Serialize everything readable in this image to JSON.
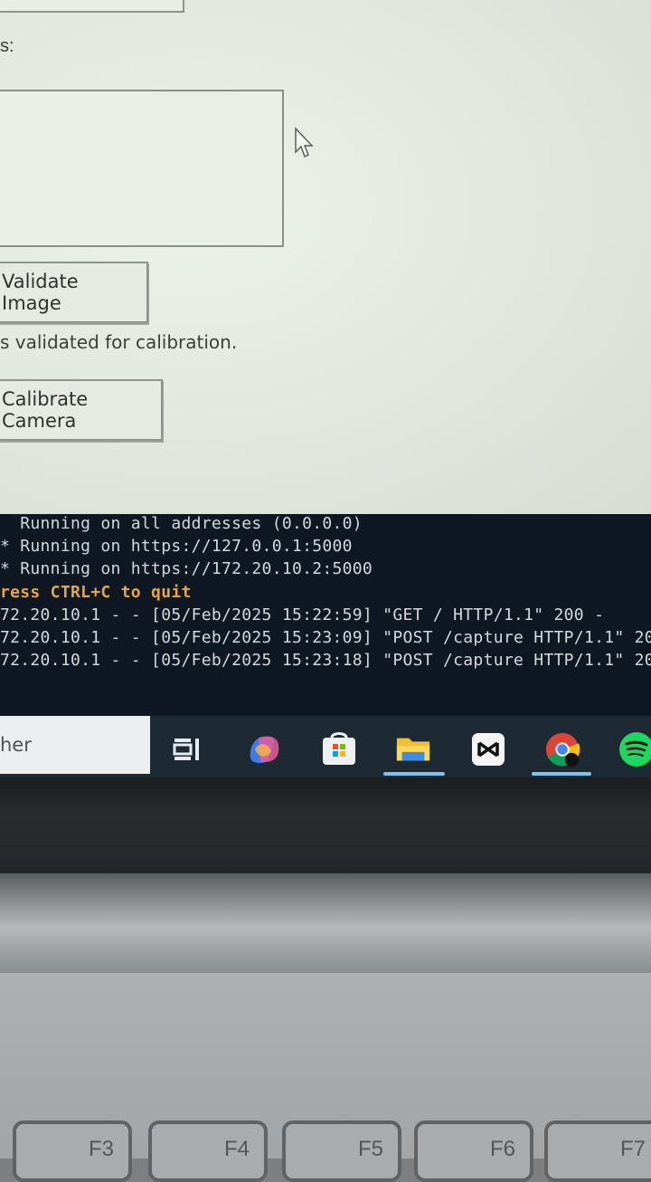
{
  "app": {
    "field_label": "s:",
    "validate_button": "Validate Image",
    "status_message": "s validated for calibration.",
    "calibrate_button": "Calibrate Camera"
  },
  "terminal": {
    "lines": [
      "  Running on all addresses (0.0.0.0)",
      "* Running on https://127.0.0.1:5000",
      "* Running on https://172.20.10.2:5000",
      "ress CTRL+C to quit",
      "72.20.10.1 - - [05/Feb/2025 15:22:59] \"GET / HTTP/1.1\" 200 -",
      "72.20.10.1 - - [05/Feb/2025 15:23:09] \"POST /capture HTTP/1.1\" 200",
      "72.20.10.1 - - [05/Feb/2025 15:23:18] \"POST /capture HTTP/1.1\" 200"
    ]
  },
  "taskbar": {
    "search_text": "her",
    "icons": [
      "task-view-icon",
      "copilot-icon",
      "microsoft-store-icon",
      "file-explorer-icon",
      "capcut-icon",
      "chrome-icon",
      "spotify-icon"
    ]
  },
  "keyboard": {
    "keys": [
      "F3",
      "F4",
      "F5",
      "F6",
      "F7"
    ]
  },
  "colors": {
    "terminal_bg": "#0f1722",
    "terminal_text": "#d4d8dc",
    "quit_text": "#e8a640",
    "taskbar_bg": "#1e2a33",
    "active_underline": "#7fc3ec"
  }
}
